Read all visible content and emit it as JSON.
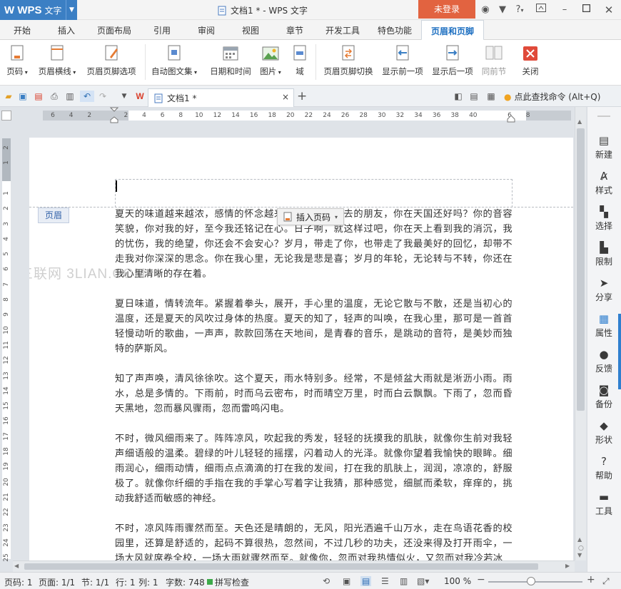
{
  "app": {
    "name_logo": "W WPS",
    "name_cn": "文字",
    "title": "文档1 * - WPS 文字",
    "login": "未登录",
    "help": "?"
  },
  "tabs": [
    "开始",
    "插入",
    "页面布局",
    "引用",
    "审阅",
    "视图",
    "章节",
    "开发工具",
    "特色功能",
    "页眉和页脚"
  ],
  "ribbon": {
    "page_number": "页码",
    "header_line": "页眉横线",
    "header_footer_options": "页眉页脚选项",
    "autotext": "自动图文集",
    "date_time": "日期和时间",
    "picture": "图片",
    "field": "域",
    "switch": "页眉页脚切换",
    "show_prev": "显示前一项",
    "show_next": "显示后一项",
    "same_prev": "同前节",
    "close": "关闭"
  },
  "doc_tab": {
    "title": "文档1 *",
    "close": "×",
    "add": "+"
  },
  "find_command": "点此查找命令 (Alt+Q)",
  "hruler": [
    "6",
    "4",
    "2",
    "",
    "2",
    "4",
    "6",
    "8",
    "10",
    "12",
    "14",
    "16",
    "18",
    "20",
    "22",
    "24",
    "26",
    "28",
    "30",
    "32",
    "34",
    "36",
    "38",
    "40",
    "",
    "6",
    "8"
  ],
  "vruler": [
    "2",
    "1",
    "",
    "1",
    "2",
    "3",
    "4",
    "5",
    "6",
    "7",
    "8",
    "9",
    "10",
    "11",
    "12",
    "13",
    "14",
    "15",
    "16",
    "17",
    "18",
    "19",
    "20",
    "21",
    "22",
    "23",
    "24",
    "25"
  ],
  "header_tag": "页眉",
  "insert_page_number": "插入页码",
  "watermark": "三联网 3LIAN.COM",
  "paragraphs": [
    "夏天的味道越来越浓，感情的怀念越来越深。那些远去的朋友，你在天国还好吗？你的音容笑貌，你对我的好，至今我还铭记在心。日子啊，就这样过吧，你在天上看到我的消沉，我的忧伤，我的绝望，你还会不会安心？岁月，带走了你，也带走了我最美好的回忆，却带不走我对你深深的思念。你在我心里，无论我是悲是喜；岁月的年轮，无论转与不转，你还在我心里清晰的存在着。",
    "夏日味道，情转流年。紧握着拳头，展开，手心里的温度，无论它散与不散，还是当初心的温度，还是夏天的风吹过身体的热度。夏天的知了，轻声的叫唤，在我心里，那可是一首首轻慢动听的歌曲，一声声，款款回荡在天地间，是青春的音乐，是跳动的音符，是美妙而独特的萨斯风。",
    "知了声声唤，清风徐徐吹。这个夏天，雨水特别多。经常，不是倾盆大雨就是淅沥小雨。雨水，总是多情的。下雨前，时而乌云密布，时而晴空万里，时而白云飘飘。下雨了，忽而昏天黑地，忽而暴风骤雨，忽而雷鸣闪电。",
    "不时，微风细雨来了。阵阵凉风，吹起我的秀发，轻轻的抚摸我的肌肤，就像你生前对我轻声细语般的温柔。碧绿的叶儿轻轻的摇摆，闪着动人的光泽。就像你望着我愉快的眼眸。细雨润心，细雨动情，细雨点点滴滴的打在我的发间，打在我的肌肤上，润润，凉凉的，舒服极了。就像你纤细的手指在我的手掌心写着字让我猜，那种感觉，细腻而柔软，痒痒的，挑动我舒适而敏感的神经。",
    "不时，凉风阵雨骤然而至。天色还是晴朗的，无风，阳光洒遍千山万水，走在鸟语花香的校园里，还算是舒适的，起码不算很热，忽然间，不过几秒的功夫，还没来得及打开雨伞，一场大风就席卷全校，一场大雨就骤然而至。就像你，忽而对我热情似火，又忽而对我冷若冰"
  ],
  "side_panel": [
    "新建",
    "样式",
    "选择",
    "限制",
    "分享",
    "属性",
    "反馈",
    "备份",
    "形状",
    "帮助",
    "工具"
  ],
  "status": {
    "page_num": "页码: 1",
    "pages": "页面: 1/1",
    "section": "节: 1/1",
    "row": "行: 1",
    "col": "列: 1",
    "words": "字数: 748",
    "spell": "拼写检查",
    "zoom": "100 %",
    "zoom_level": 1.0
  }
}
